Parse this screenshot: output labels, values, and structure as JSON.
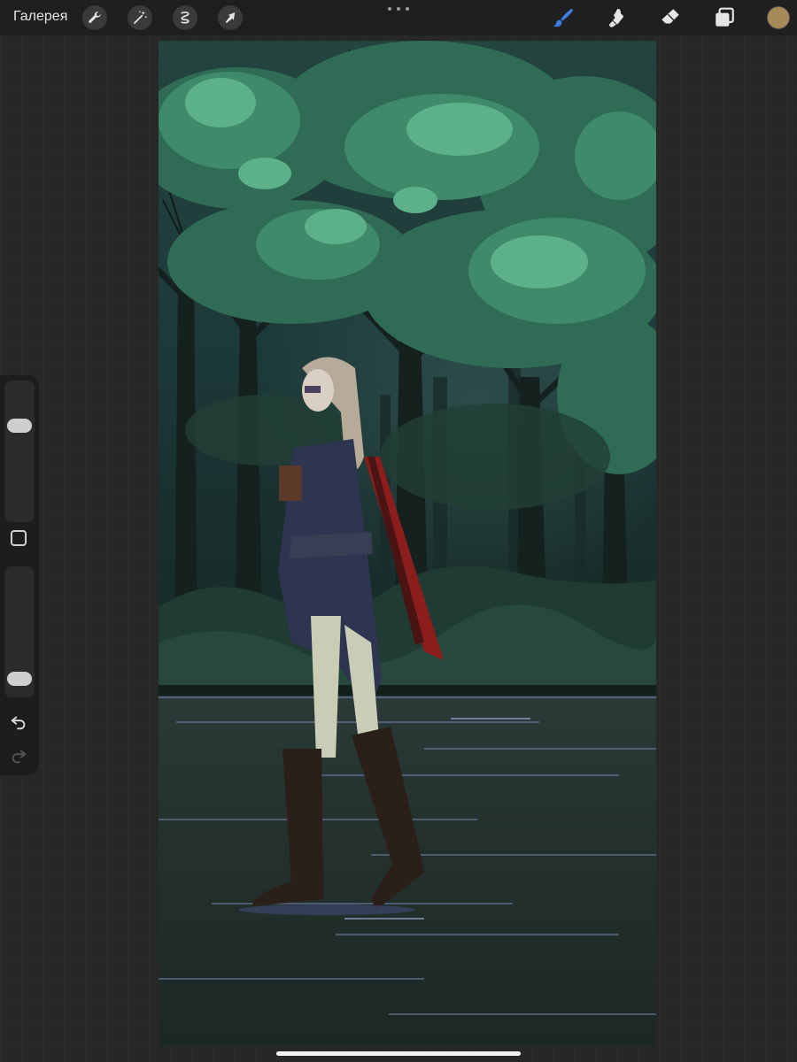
{
  "toolbar": {
    "gallery_label": "Галерея",
    "left_tools": [
      {
        "name": "wrench-icon",
        "action": "actions"
      },
      {
        "name": "magic-wand-icon",
        "action": "adjustments"
      },
      {
        "name": "selection-icon",
        "action": "selection"
      },
      {
        "name": "arrow-cursor-icon",
        "action": "transform"
      }
    ],
    "right_tools": [
      {
        "name": "brush-icon",
        "action": "paint",
        "active": true
      },
      {
        "name": "smudge-icon",
        "action": "smudge",
        "active": false
      },
      {
        "name": "eraser-icon",
        "action": "erase",
        "active": false
      },
      {
        "name": "layers-icon",
        "action": "layers",
        "active": false
      }
    ],
    "current_color": "#a78a5a"
  },
  "sidebar": {
    "brush_size_level": 0.71,
    "opacity_level": 0.08
  },
  "colors": {
    "active_tool": "#3d7de0",
    "icon": "#e0e0e0",
    "toolbar_bg": "#1f1f1f",
    "workspace_bg": "#272727"
  }
}
